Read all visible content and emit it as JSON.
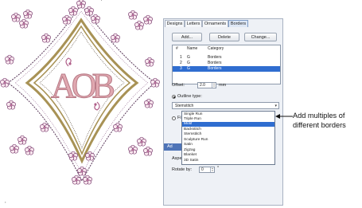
{
  "tabs": [
    "Designs",
    "Letters",
    "Ornaments",
    "Borders"
  ],
  "buttons": {
    "add": "Add...",
    "delete": "Delete",
    "change": "Change..."
  },
  "list": {
    "headers": [
      "#",
      "Name",
      "Category"
    ],
    "rows": [
      [
        "1",
        "G",
        "Borders"
      ],
      [
        "2",
        "G",
        "Borders"
      ],
      [
        "3",
        "G",
        "Borders"
      ]
    ]
  },
  "offset": {
    "label": "Offset:",
    "value": "2.0",
    "unit": "mm"
  },
  "outline": {
    "label": "Outline type:",
    "value": "Stemstitch"
  },
  "outline_options": [
    "Single Run",
    "Triple Run",
    "Motif",
    "Backstitch",
    "Stemstitch",
    "Sculpture Run",
    "Satin",
    "Zigzag",
    "Blanket",
    "3D Satin"
  ],
  "outline_selected": "Motif",
  "fill_radio_label": "Fi",
  "section_label": "Ad",
  "aspect_label": "Aspec",
  "rotate": {
    "label": "Rotate by:",
    "value": "0",
    "unit": "°"
  },
  "monogram": "AOB",
  "annotation": "Add multiples of different borders",
  "colors": {
    "accent": "#2f6dd0",
    "border_gold": "#a89255",
    "letters": "#e0a8b0",
    "flower": "#7a3f70"
  }
}
